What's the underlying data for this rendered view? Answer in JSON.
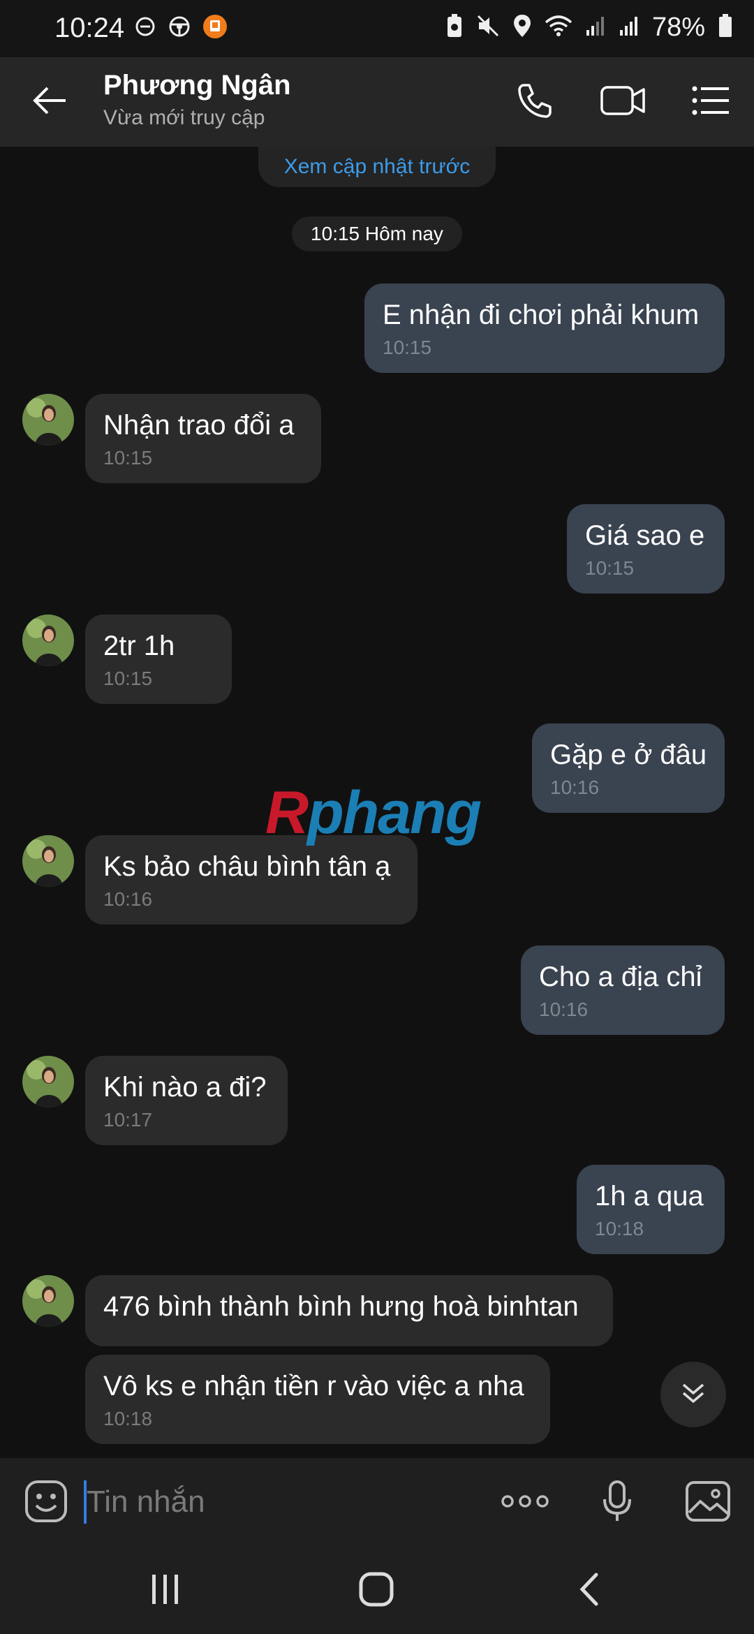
{
  "status_bar": {
    "time": "10:24",
    "battery_percent": "78%",
    "icons_left": [
      "do-not-disturb-icon",
      "steering-wheel-icon",
      "delivery-app-icon"
    ],
    "icons_right": [
      "battery-saver-icon",
      "mute-icon",
      "location-icon",
      "wifi-icon",
      "signal-icon",
      "signal-icon",
      "battery-icon"
    ]
  },
  "header": {
    "contact_name": "Phương Ngân",
    "contact_status": "Vừa mới truy cập",
    "icons": [
      "back-arrow-icon",
      "phone-icon",
      "video-call-icon",
      "menu-list-icon"
    ]
  },
  "chat": {
    "load_older_label": "Xem cập nhật trước",
    "date_label": "10:15 Hôm nay",
    "messages": [
      {
        "direction": "out",
        "text": "E nhận đi chơi phải khum",
        "time": "10:15"
      },
      {
        "direction": "in",
        "text": "Nhận trao đổi a",
        "time": "10:15"
      },
      {
        "direction": "out",
        "text": "Giá sao e",
        "time": "10:15"
      },
      {
        "direction": "in",
        "text": "2tr 1h",
        "time": "10:15"
      },
      {
        "direction": "out",
        "text": "Gặp e ở đâu",
        "time": "10:16"
      },
      {
        "direction": "in",
        "text": "Ks bảo châu bình tân ạ",
        "time": "10:16"
      },
      {
        "direction": "out",
        "text": "Cho a địa chỉ",
        "time": "10:16"
      },
      {
        "direction": "in",
        "text": "Khi nào a đi?",
        "time": "10:17"
      },
      {
        "direction": "out",
        "text": "1h a qua",
        "time": "10:18"
      },
      {
        "direction": "in",
        "text": "476 bình thành bình hưng hoà binhtan",
        "time": ""
      },
      {
        "direction": "in",
        "text": "Vô ks e nhận tiền r vào việc a nha",
        "time": "10:18"
      }
    ]
  },
  "watermark": {
    "first_letter": "R",
    "rest": "phang"
  },
  "input": {
    "placeholder": "Tin nhắn",
    "icons": [
      "emoji-icon",
      "more-dots-icon",
      "microphone-icon",
      "image-icon"
    ]
  },
  "navigation": {
    "icons": [
      "recent-apps-icon",
      "home-icon",
      "back-icon"
    ]
  },
  "colors": {
    "background": "#111111",
    "header": "#262626",
    "outgoing_bubble": "#3a4350",
    "incoming_bubble": "#2b2b2b",
    "link_blue": "#3d9be9",
    "caret_blue": "#2f7ee8"
  }
}
